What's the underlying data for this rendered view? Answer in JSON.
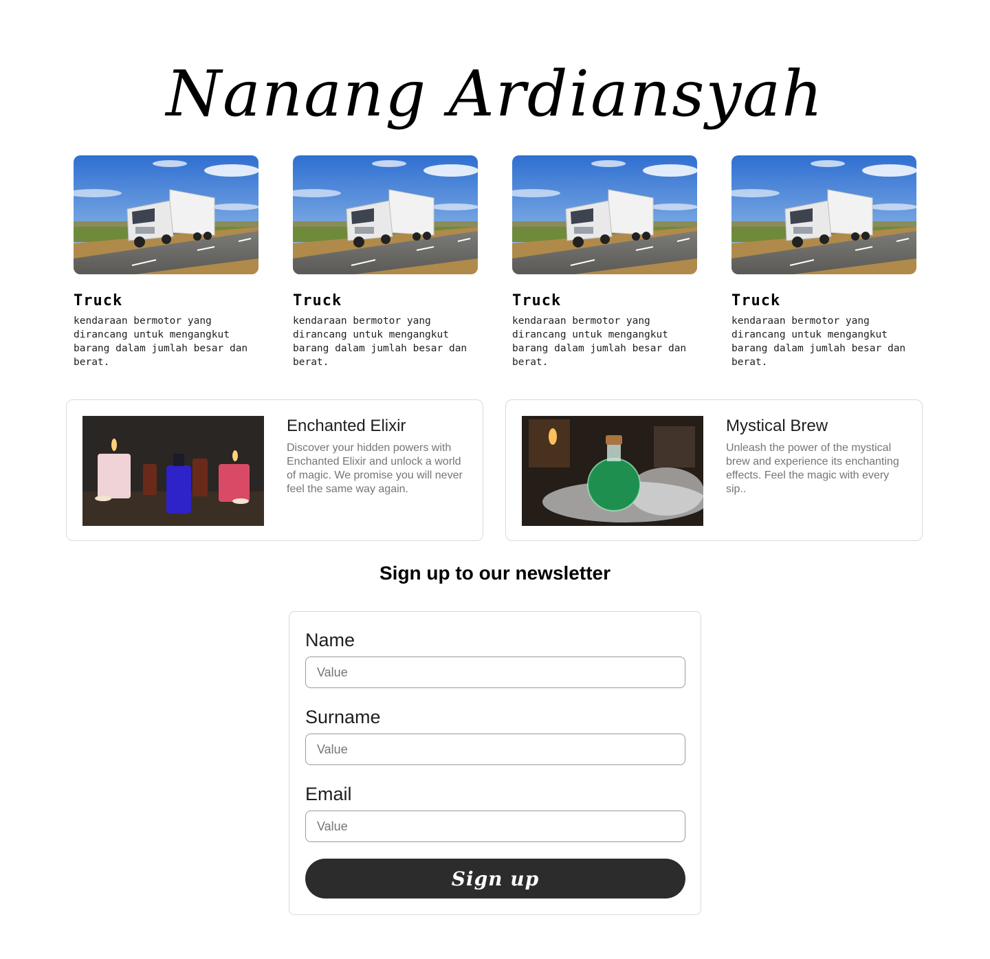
{
  "header": {
    "title": "Nanang Ardiansyah"
  },
  "trucks": [
    {
      "title": "Truck",
      "description": "kendaraan bermotor yang dirancang untuk mengangkut barang dalam jumlah besar dan berat.",
      "image": "truck-photo"
    },
    {
      "title": "Truck",
      "description": "kendaraan bermotor yang dirancang untuk mengangkut barang dalam jumlah besar dan berat.",
      "image": "truck-photo"
    },
    {
      "title": "Truck",
      "description": "kendaraan bermotor yang dirancang untuk mengangkut barang dalam jumlah besar dan berat.",
      "image": "truck-photo"
    },
    {
      "title": "Truck",
      "description": "kendaraan bermotor yang dirancang untuk mengangkut barang dalam jumlah besar dan berat.",
      "image": "truck-photo"
    }
  ],
  "products": [
    {
      "title": "Enchanted Elixir",
      "description": "Discover your hidden powers with Enchanted Elixir and unlock a world of magic. We promise you will never feel the same way again.",
      "image": "candles-potion-photo"
    },
    {
      "title": "Mystical Brew",
      "description": "Unleash the power of the mystical brew and experience its enchanting effects. Feel the magic with every sip..",
      "image": "green-potion-photo"
    }
  ],
  "newsletter": {
    "heading": "Sign up to our newsletter",
    "fields": [
      {
        "label": "Name",
        "placeholder": "Value"
      },
      {
        "label": "Surname",
        "placeholder": "Value"
      },
      {
        "label": "Email",
        "placeholder": "Value"
      }
    ],
    "submit_label": "Sign up"
  },
  "colors": {
    "button_bg": "#2c2c2c",
    "border": "#d9d9d9",
    "muted_text": "#757575"
  }
}
